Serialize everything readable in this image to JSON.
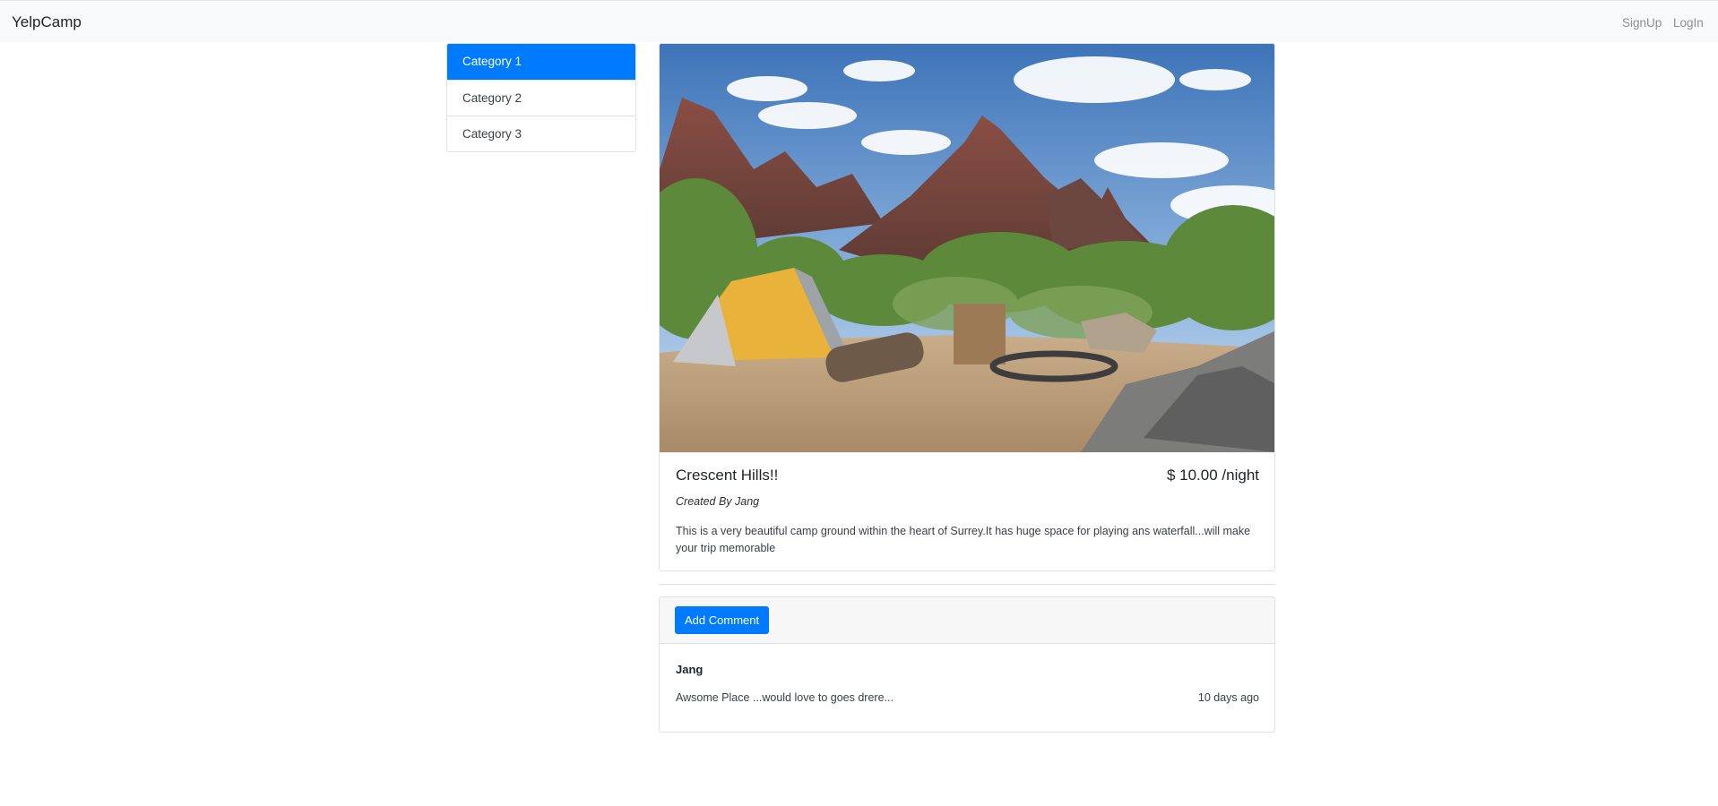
{
  "navbar": {
    "brand": "YelpCamp",
    "links": [
      {
        "label": "SignUp"
      },
      {
        "label": "LogIn"
      }
    ]
  },
  "sidebar": {
    "categories": [
      {
        "label": "Category 1",
        "active": true
      },
      {
        "label": "Category 2",
        "active": false
      },
      {
        "label": "Category 3",
        "active": false
      }
    ]
  },
  "campground": {
    "name": "Crescent Hills!!",
    "price": "$ 10.00 /night",
    "author": "Created By Jang",
    "description": "This is a very beautiful camp ground within the heart of Surrey.It has huge space for playing ans waterfall...will make your trip memorable"
  },
  "comments": {
    "add_button_label": "Add Comment",
    "items": [
      {
        "author": "Jang",
        "text": "Awsome Place ...would love to goes drere...",
        "time": "10 days ago"
      }
    ]
  },
  "colors": {
    "primary": "#007bff",
    "navbar_bg": "#f8f9fa"
  }
}
